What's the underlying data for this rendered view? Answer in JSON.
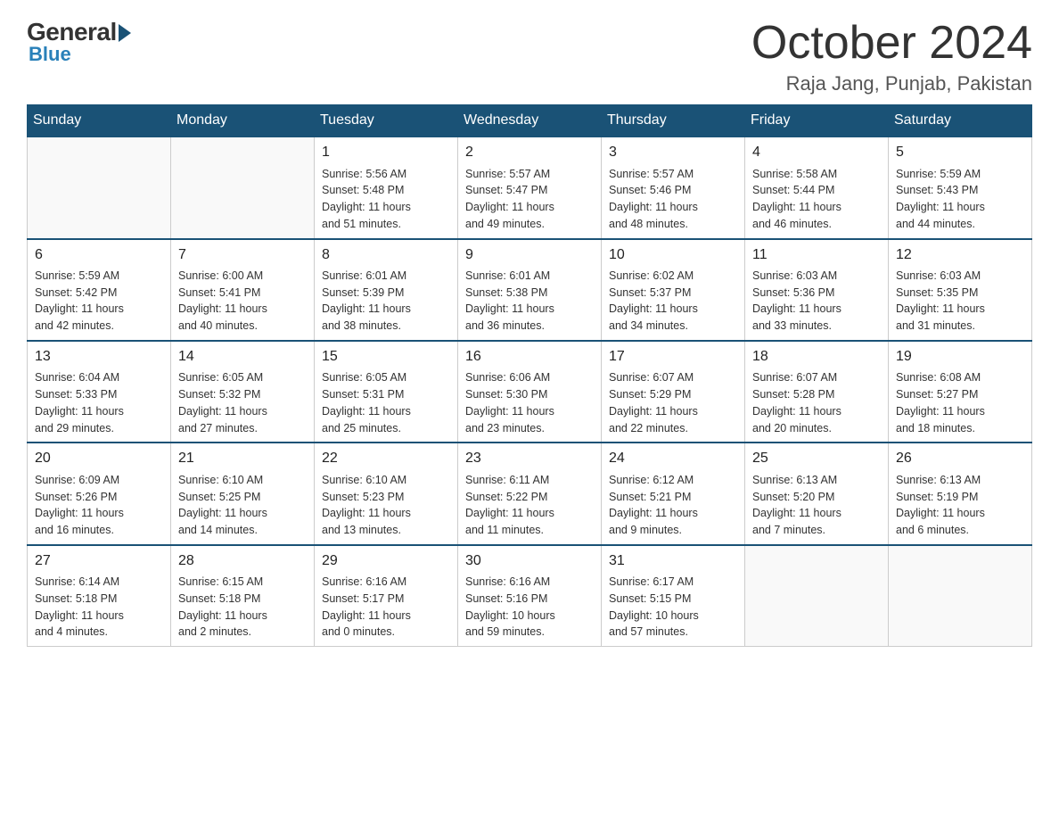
{
  "logo": {
    "general": "General",
    "blue": "Blue"
  },
  "title": "October 2024",
  "location": "Raja Jang, Punjab, Pakistan",
  "weekdays": [
    "Sunday",
    "Monday",
    "Tuesday",
    "Wednesday",
    "Thursday",
    "Friday",
    "Saturday"
  ],
  "weeks": [
    [
      {
        "day": "",
        "info": ""
      },
      {
        "day": "",
        "info": ""
      },
      {
        "day": "1",
        "info": "Sunrise: 5:56 AM\nSunset: 5:48 PM\nDaylight: 11 hours\nand 51 minutes."
      },
      {
        "day": "2",
        "info": "Sunrise: 5:57 AM\nSunset: 5:47 PM\nDaylight: 11 hours\nand 49 minutes."
      },
      {
        "day": "3",
        "info": "Sunrise: 5:57 AM\nSunset: 5:46 PM\nDaylight: 11 hours\nand 48 minutes."
      },
      {
        "day": "4",
        "info": "Sunrise: 5:58 AM\nSunset: 5:44 PM\nDaylight: 11 hours\nand 46 minutes."
      },
      {
        "day": "5",
        "info": "Sunrise: 5:59 AM\nSunset: 5:43 PM\nDaylight: 11 hours\nand 44 minutes."
      }
    ],
    [
      {
        "day": "6",
        "info": "Sunrise: 5:59 AM\nSunset: 5:42 PM\nDaylight: 11 hours\nand 42 minutes."
      },
      {
        "day": "7",
        "info": "Sunrise: 6:00 AM\nSunset: 5:41 PM\nDaylight: 11 hours\nand 40 minutes."
      },
      {
        "day": "8",
        "info": "Sunrise: 6:01 AM\nSunset: 5:39 PM\nDaylight: 11 hours\nand 38 minutes."
      },
      {
        "day": "9",
        "info": "Sunrise: 6:01 AM\nSunset: 5:38 PM\nDaylight: 11 hours\nand 36 minutes."
      },
      {
        "day": "10",
        "info": "Sunrise: 6:02 AM\nSunset: 5:37 PM\nDaylight: 11 hours\nand 34 minutes."
      },
      {
        "day": "11",
        "info": "Sunrise: 6:03 AM\nSunset: 5:36 PM\nDaylight: 11 hours\nand 33 minutes."
      },
      {
        "day": "12",
        "info": "Sunrise: 6:03 AM\nSunset: 5:35 PM\nDaylight: 11 hours\nand 31 minutes."
      }
    ],
    [
      {
        "day": "13",
        "info": "Sunrise: 6:04 AM\nSunset: 5:33 PM\nDaylight: 11 hours\nand 29 minutes."
      },
      {
        "day": "14",
        "info": "Sunrise: 6:05 AM\nSunset: 5:32 PM\nDaylight: 11 hours\nand 27 minutes."
      },
      {
        "day": "15",
        "info": "Sunrise: 6:05 AM\nSunset: 5:31 PM\nDaylight: 11 hours\nand 25 minutes."
      },
      {
        "day": "16",
        "info": "Sunrise: 6:06 AM\nSunset: 5:30 PM\nDaylight: 11 hours\nand 23 minutes."
      },
      {
        "day": "17",
        "info": "Sunrise: 6:07 AM\nSunset: 5:29 PM\nDaylight: 11 hours\nand 22 minutes."
      },
      {
        "day": "18",
        "info": "Sunrise: 6:07 AM\nSunset: 5:28 PM\nDaylight: 11 hours\nand 20 minutes."
      },
      {
        "day": "19",
        "info": "Sunrise: 6:08 AM\nSunset: 5:27 PM\nDaylight: 11 hours\nand 18 minutes."
      }
    ],
    [
      {
        "day": "20",
        "info": "Sunrise: 6:09 AM\nSunset: 5:26 PM\nDaylight: 11 hours\nand 16 minutes."
      },
      {
        "day": "21",
        "info": "Sunrise: 6:10 AM\nSunset: 5:25 PM\nDaylight: 11 hours\nand 14 minutes."
      },
      {
        "day": "22",
        "info": "Sunrise: 6:10 AM\nSunset: 5:23 PM\nDaylight: 11 hours\nand 13 minutes."
      },
      {
        "day": "23",
        "info": "Sunrise: 6:11 AM\nSunset: 5:22 PM\nDaylight: 11 hours\nand 11 minutes."
      },
      {
        "day": "24",
        "info": "Sunrise: 6:12 AM\nSunset: 5:21 PM\nDaylight: 11 hours\nand 9 minutes."
      },
      {
        "day": "25",
        "info": "Sunrise: 6:13 AM\nSunset: 5:20 PM\nDaylight: 11 hours\nand 7 minutes."
      },
      {
        "day": "26",
        "info": "Sunrise: 6:13 AM\nSunset: 5:19 PM\nDaylight: 11 hours\nand 6 minutes."
      }
    ],
    [
      {
        "day": "27",
        "info": "Sunrise: 6:14 AM\nSunset: 5:18 PM\nDaylight: 11 hours\nand 4 minutes."
      },
      {
        "day": "28",
        "info": "Sunrise: 6:15 AM\nSunset: 5:18 PM\nDaylight: 11 hours\nand 2 minutes."
      },
      {
        "day": "29",
        "info": "Sunrise: 6:16 AM\nSunset: 5:17 PM\nDaylight: 11 hours\nand 0 minutes."
      },
      {
        "day": "30",
        "info": "Sunrise: 6:16 AM\nSunset: 5:16 PM\nDaylight: 10 hours\nand 59 minutes."
      },
      {
        "day": "31",
        "info": "Sunrise: 6:17 AM\nSunset: 5:15 PM\nDaylight: 10 hours\nand 57 minutes."
      },
      {
        "day": "",
        "info": ""
      },
      {
        "day": "",
        "info": ""
      }
    ]
  ]
}
